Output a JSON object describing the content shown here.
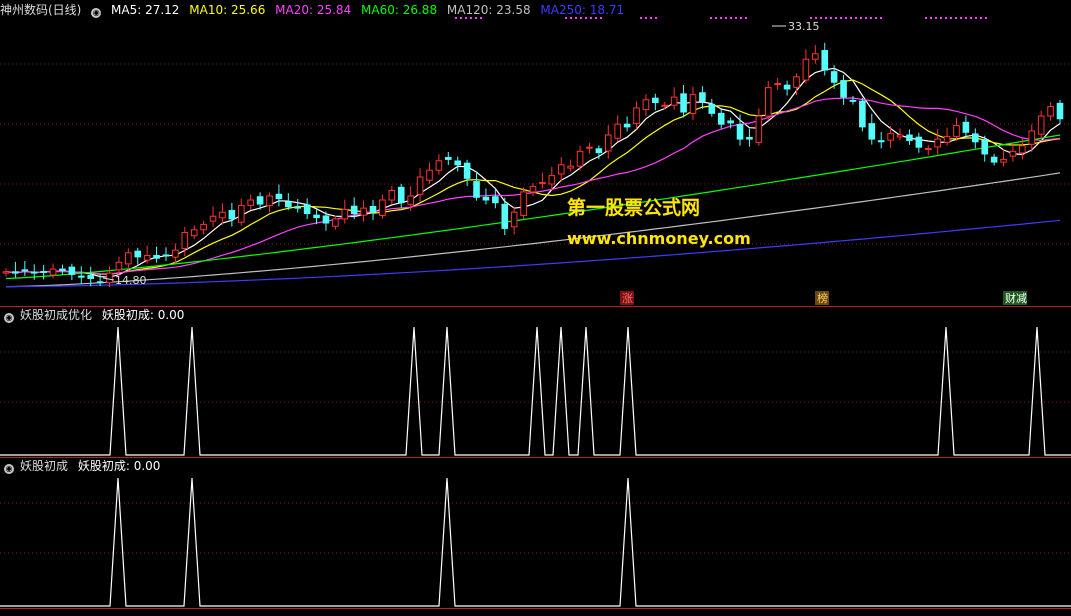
{
  "main_panel": {
    "title": "神州数码(日线)",
    "ma_labels": [
      {
        "text": "MA5: 27.12",
        "color": "#ffffff"
      },
      {
        "text": "MA10: 25.66",
        "color": "#ffff00"
      },
      {
        "text": "MA20: 25.84",
        "color": "#ff40ff"
      },
      {
        "text": "MA60: 26.88",
        "color": "#00ff00"
      },
      {
        "text": "MA120: 23.58",
        "color": "#c0c0c0"
      },
      {
        "text": "MA250: 18.71",
        "color": "#3c3cff"
      }
    ],
    "high_label": "33.15",
    "low_label": "14.80",
    "watermark_title": "第一股票公式网",
    "watermark_url": "www.chnmoney.com",
    "event_markers": [
      {
        "text": "涨",
        "bg": "#7a1414",
        "color": "#ff6a6a"
      },
      {
        "text": "榜",
        "bg": "#6a4a10",
        "color": "#ffcc66"
      },
      {
        "text": "财减",
        "bg": "#1e5a1e",
        "color": "#ffffff"
      }
    ]
  },
  "indicator1": {
    "title": "妖股初成优化",
    "value_label": "妖股初成: 0.00"
  },
  "indicator2": {
    "title": "妖股初成",
    "value_label": "妖股初成: 0.00"
  },
  "chart_data": [
    {
      "type": "candlestick",
      "title": "神州数码(日线)",
      "ylim": [
        14.5,
        34
      ],
      "series": [
        {
          "name": "MA5",
          "color": "#ffffff"
        },
        {
          "name": "MA10",
          "color": "#ffff00"
        },
        {
          "name": "MA20",
          "color": "#ff40ff"
        },
        {
          "name": "MA60",
          "color": "#00ff00"
        },
        {
          "name": "MA120",
          "color": "#c0c0c0"
        },
        {
          "name": "MA250",
          "color": "#3c3cff"
        }
      ],
      "close": [
        15.7,
        15.6,
        15.8,
        15.6,
        15.7,
        15.9,
        15.8,
        15.5,
        15.3,
        15.2,
        14.9,
        15.6,
        16.4,
        17.1,
        16.8,
        16.9,
        16.7,
        16.9,
        17.3,
        18.6,
        18.8,
        19.2,
        19.8,
        20.1,
        19.6,
        20.6,
        21.0,
        20.7,
        21.3,
        21.1,
        20.5,
        20.4,
        20.0,
        19.7,
        19.3,
        19.6,
        20.3,
        20.0,
        20.4,
        20.1,
        21.0,
        21.7,
        20.8,
        21.3,
        22.7,
        23.2,
        23.9,
        24.0,
        23.6,
        22.6,
        21.2,
        21.0,
        20.8,
        18.9,
        20.1,
        21.6,
        22.0,
        22.3,
        22.8,
        23.6,
        23.5,
        24.6,
        24.9,
        24.5,
        25.8,
        26.6,
        26.4,
        27.8,
        28.4,
        28.2,
        28.0,
        28.6,
        27.5,
        28.8,
        28.3,
        27.4,
        26.6,
        26.7,
        25.5,
        25.5,
        27.2,
        29.3,
        29.6,
        29.2,
        30.1,
        31.4,
        31.8,
        30.6,
        29.7,
        28.6,
        28.3,
        26.4,
        25.5,
        25.3,
        25.9,
        25.8,
        25.4,
        24.9,
        24.8,
        25.5,
        25.7,
        26.5,
        26.0,
        25.3,
        24.4,
        23.8,
        24.0,
        24.6,
        25.0,
        26.1,
        27.2,
        27.9,
        27.0
      ],
      "high_value": 33.15,
      "low_value": 14.8
    },
    {
      "type": "line",
      "title": "妖股初成优化",
      "series": [
        {
          "name": "妖股初成",
          "signal_positions": [
            118,
            192,
            414,
            447,
            537,
            561,
            586,
            628,
            946,
            1037
          ]
        }
      ],
      "ylim": [
        0,
        1
      ]
    },
    {
      "type": "line",
      "title": "妖股初成",
      "series": [
        {
          "name": "妖股初成",
          "signal_positions": [
            118,
            192,
            447,
            628
          ]
        }
      ],
      "ylim": [
        0,
        1
      ]
    }
  ]
}
